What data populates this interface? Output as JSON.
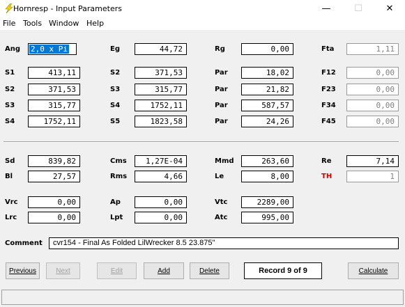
{
  "window": {
    "title": "Hornresp - Input Parameters",
    "minimize": "—",
    "maximize": "☐",
    "close": "✕"
  },
  "menu": [
    "File",
    "Tools",
    "Window",
    "Help"
  ],
  "rows_top": [
    {
      "c1": {
        "label": "Ang",
        "value": "2,0 x Pi"
      },
      "c2": {
        "label": "Eg",
        "value": "44,72"
      },
      "c3": {
        "label": "Rg",
        "value": "0,00"
      },
      "c4": {
        "label": "Fta",
        "value": "1,11"
      }
    },
    {
      "c1": {
        "label": "S1",
        "value": "413,11"
      },
      "c2": {
        "label": "S2",
        "value": "371,53"
      },
      "c3": {
        "label": "Par",
        "value": "18,02"
      },
      "c4": {
        "label": "F12",
        "value": "0,00"
      }
    },
    {
      "c1": {
        "label": "S2",
        "value": "371,53"
      },
      "c2": {
        "label": "S3",
        "value": "315,77"
      },
      "c3": {
        "label": "Par",
        "value": "21,82"
      },
      "c4": {
        "label": "F23",
        "value": "0,00"
      }
    },
    {
      "c1": {
        "label": "S3",
        "value": "315,77"
      },
      "c2": {
        "label": "S4",
        "value": "1752,11"
      },
      "c3": {
        "label": "Par",
        "value": "587,57"
      },
      "c4": {
        "label": "F34",
        "value": "0,00"
      }
    },
    {
      "c1": {
        "label": "S4",
        "value": "1752,11"
      },
      "c2": {
        "label": "S5",
        "value": "1823,58"
      },
      "c3": {
        "label": "Par",
        "value": "24,26"
      },
      "c4": {
        "label": "F45",
        "value": "0,00"
      }
    }
  ],
  "driver": {
    "sd": {
      "label": "Sd",
      "value": "839,82"
    },
    "cms": {
      "label": "Cms",
      "value": "1,27E-04"
    },
    "mmd": {
      "label": "Mmd",
      "value": "263,60"
    },
    "re": {
      "label": "Re",
      "value": "7,14"
    },
    "bl": {
      "label": "Bl",
      "value": "27,57"
    },
    "rms": {
      "label": "Rms",
      "value": "4,66"
    },
    "le": {
      "label": "Le",
      "value": "8,00"
    },
    "th": {
      "label": "TH",
      "value": "1"
    }
  },
  "chambers": {
    "vrc": {
      "label": "Vrc",
      "value": "0,00"
    },
    "ap": {
      "label": "Ap",
      "value": "0,00"
    },
    "vtc": {
      "label": "Vtc",
      "value": "2289,00"
    },
    "lrc": {
      "label": "Lrc",
      "value": "0,00"
    },
    "lpt": {
      "label": "Lpt",
      "value": "0,00"
    },
    "atc": {
      "label": "Atc",
      "value": "995,00"
    }
  },
  "comment": {
    "label": "Comment",
    "value": "cvr154 - Final As Folded LilWrecker 8.5 23.875\""
  },
  "buttons": {
    "previous": "Previous",
    "next": "Next",
    "edit": "Edit",
    "add": "Add",
    "delete": "Delete",
    "record": "Record 9 of 9",
    "calculate": "Calculate"
  },
  "colors": {
    "th_label": "#d40000",
    "selection": "#0078d7"
  }
}
